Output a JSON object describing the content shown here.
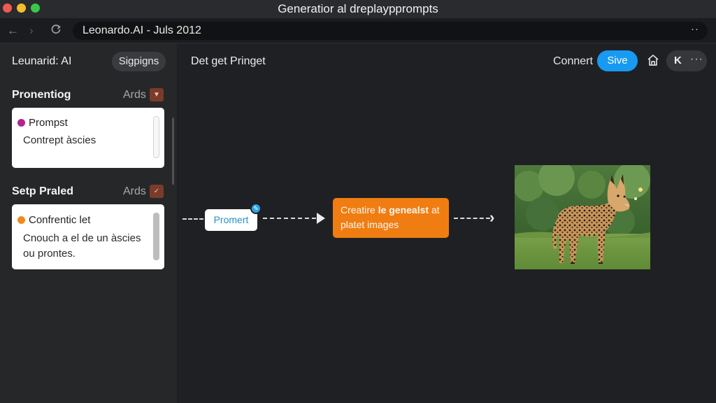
{
  "window": {
    "title": "Generatior al dreplaypprompts"
  },
  "nav": {
    "address": "Leonardo.AI - Juls 2012",
    "back_icon": "arrow-left-icon",
    "forward_icon": "arrow-right-icon",
    "reload_icon": "reload-icon",
    "more_label": "··"
  },
  "sidebar": {
    "brand": "Leunarid: AI",
    "signin_label": "Sigpigns",
    "sections": [
      {
        "title": "Pronentiog",
        "ards_label": "Ards",
        "card": {
          "head": "Prompst",
          "body": "Contrept àscies",
          "dot_color": "#b0258f"
        }
      },
      {
        "title": "Setp Praled",
        "ards_label": "Ards",
        "card": {
          "head": "Confrentic let",
          "body": "Cnouch a el de un àscies ou prontes.",
          "dot_color": "#f28a1a"
        }
      }
    ]
  },
  "main": {
    "title": "Det get Pringet",
    "connect_label": "Connert",
    "save_label": "Sive",
    "home_icon": "home-icon",
    "k_label": "K",
    "more_label": "···"
  },
  "flow": {
    "prompt_node": "Promert",
    "generate_node_pre": "Creatire",
    "generate_node_bold": "le genealst",
    "generate_node_post": "at platet images",
    "output_image": "wild-cat-photo"
  },
  "colors": {
    "accent": "#1899f2",
    "orange": "#f07d12",
    "chip": "#7a3b2a"
  }
}
